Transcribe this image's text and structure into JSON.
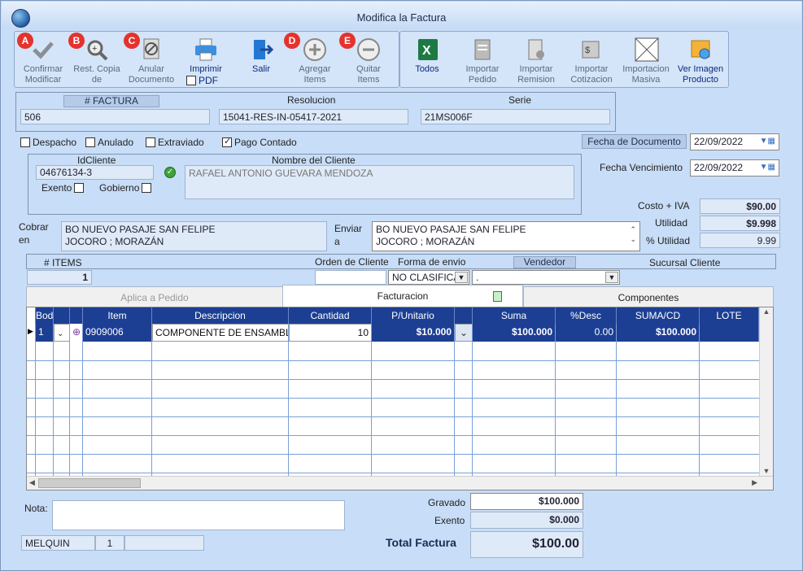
{
  "window": {
    "title": "Modifica la Factura"
  },
  "toolbar": {
    "confirm": {
      "line1": "Confirmar",
      "line2": "Modificar",
      "badge": "A"
    },
    "restore": {
      "line1": "Rest. Copia",
      "line2": "de",
      "badge": "B"
    },
    "cancel": {
      "line1": "Anular",
      "line2": "Documento",
      "badge": "C"
    },
    "print": {
      "line1": "Imprimir",
      "pdf": "PDF"
    },
    "exit": {
      "line1": "Salir"
    },
    "add": {
      "line1": "Agregar",
      "line2": "Items",
      "badge": "D"
    },
    "remove": {
      "line1": "Quitar",
      "line2": "Items",
      "badge": "E"
    },
    "todos": {
      "line1": "Todos"
    },
    "import_order": {
      "line1": "Importar",
      "line2": "Pedido"
    },
    "import_remission": {
      "line1": "Importar",
      "line2": "Remision"
    },
    "import_quote": {
      "line1": "Importar",
      "line2": "Cotizacion"
    },
    "mass_import": {
      "line1": "Importacion",
      "line2": "Masiva"
    },
    "view_image": {
      "line1": "Ver Imagen",
      "line2": "Producto"
    }
  },
  "invoice": {
    "number_label": "# FACTURA",
    "number": "506",
    "resolution_label": "Resolucion",
    "resolution": "15041-RES-IN-05417-2021",
    "series_label": "Serie",
    "series": "21MS006F"
  },
  "flags": {
    "despacho": "Despacho",
    "anulado": "Anulado",
    "extraviado": "Extraviado",
    "pago_contado": "Pago Contado"
  },
  "dates": {
    "doc_label": "Fecha de Documento",
    "doc": "22/09/2022",
    "due_label": "Fecha Vencimiento",
    "due": "22/09/2022"
  },
  "client": {
    "id_label": "IdCliente",
    "id": "04676134-3",
    "name_label": "Nombre del Cliente",
    "name": "RAFAEL ANTONIO GUEVARA MENDOZA",
    "exento": "Exento",
    "gobierno": "Gobierno"
  },
  "summary": {
    "cost_label": "Costo + IVA",
    "cost": "$90.00",
    "util_label": "Utilidad",
    "util": "$9.998",
    "pct_label": "% Utilidad",
    "pct": "9.99"
  },
  "address": {
    "cobrar_label": "Cobrar",
    "cobrar_label2": "en",
    "cobrar_line1": "BO NUEVO PASAJE SAN FELIPE",
    "cobrar_line2": "JOCORO ; MORAZÁN",
    "enviar_label": "Enviar",
    "enviar_label2": "a",
    "enviar_line1": "BO NUEVO PASAJE SAN FELIPE",
    "enviar_line2": "JOCORO ; MORAZÁN"
  },
  "meta": {
    "items_label": "# ITEMS",
    "items": "1",
    "order_label": "Orden de Cliente",
    "ship_label": "Forma de envio",
    "ship": "NO CLASIFICA",
    "seller_label": "Vendedor",
    "seller": ".",
    "branch_label": "Sucursal Cliente"
  },
  "tabs": {
    "t1": "Aplica a Pedido",
    "t2": "Facturacion",
    "t3": "Componentes"
  },
  "grid": {
    "headers": [
      "Bodega",
      "",
      "Item",
      "Descripcion",
      "Cantidad",
      "P/Unitario",
      "",
      "Suma",
      "%Desc",
      "SUMA/CD",
      "LOTE"
    ],
    "row": {
      "bodega": "1",
      "item": "0909006",
      "desc": "COMPONENTE DE ENSAMBL",
      "qty": "10",
      "unit": "$10.000",
      "sum": "$100.000",
      "desc_pct": "0.00",
      "sumcd": "$100.000"
    }
  },
  "footer": {
    "nota_label": "Nota:",
    "user": "MELQUIN",
    "user_n": "1",
    "gravado_label": "Gravado",
    "gravado": "$100.000",
    "exento_label": "Exento",
    "exento": "$0.000",
    "total_label": "Total Factura",
    "total": "$100.00"
  }
}
